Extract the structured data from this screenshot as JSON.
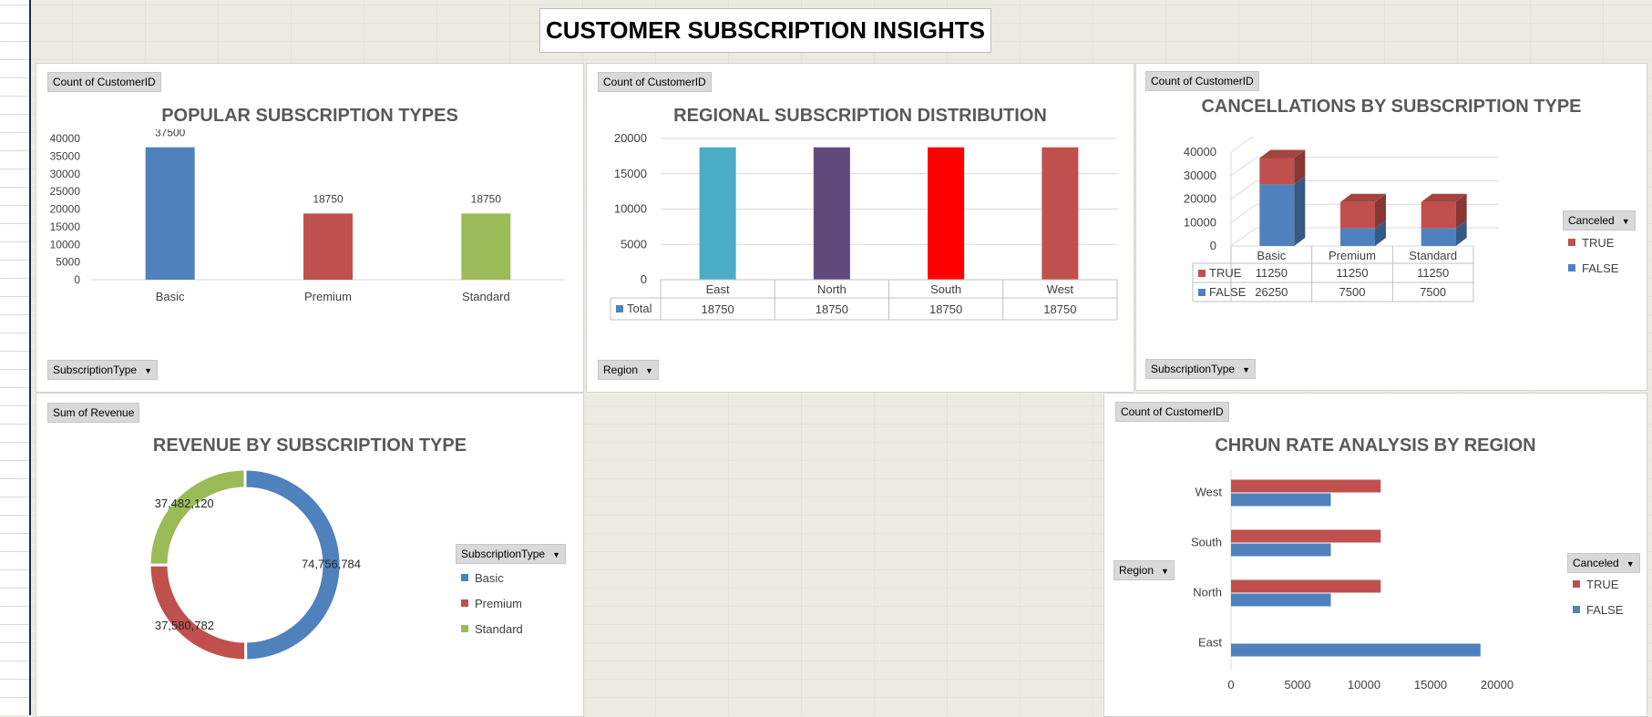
{
  "dashboard_title": "CUSTOMER SUBSCRIPTION INSIGHTS",
  "colors": {
    "blue": "#4f81bd",
    "red": "#c0504d",
    "green": "#9bbb59",
    "teal": "#4bacc6",
    "purple": "#604a7b",
    "bright_red": "#ff0000"
  },
  "panels": {
    "popular": {
      "field_button": "Count of CustomerID",
      "axis_button": "SubscriptionType",
      "title": "POPULAR SUBSCRIPTION TYPES"
    },
    "regional": {
      "field_button": "Count of CustomerID",
      "axis_button": "Region",
      "title": "REGIONAL SUBSCRIPTION DISTRIBUTION",
      "table_series_label": "Total"
    },
    "cancellations": {
      "field_button": "Count of CustomerID",
      "axis_button": "SubscriptionType",
      "legend_button": "Canceled",
      "title": "CANCELLATIONS BY SUBSCRIPTION TYPE"
    },
    "revenue": {
      "field_button": "Sum of Revenue",
      "legend_button": "SubscriptionType",
      "title": "REVENUE BY SUBSCRIPTION TYPE"
    },
    "churn": {
      "field_button": "Count of CustomerID",
      "axis_button": "Region",
      "legend_button": "Canceled",
      "title": "CHRUN RATE ANALYSIS BY REGION"
    }
  },
  "chart_data": [
    {
      "id": "popular",
      "type": "bar",
      "title": "POPULAR SUBSCRIPTION TYPES",
      "categories": [
        "Basic",
        "Premium",
        "Standard"
      ],
      "values": [
        37500,
        18750,
        18750
      ],
      "data_labels": [
        "37500",
        "18750",
        "18750"
      ],
      "bar_colors": [
        "#4f81bd",
        "#c0504d",
        "#9bbb59"
      ],
      "ylim": [
        0,
        40000
      ],
      "yticks": [
        "0",
        "5000",
        "10000",
        "15000",
        "20000",
        "25000",
        "30000",
        "35000",
        "40000"
      ],
      "grid": false
    },
    {
      "id": "regional",
      "type": "bar",
      "title": "REGIONAL SUBSCRIPTION DISTRIBUTION",
      "categories": [
        "East",
        "North",
        "South",
        "West"
      ],
      "series": [
        {
          "name": "Total",
          "values": [
            18750,
            18750,
            18750,
            18750
          ]
        }
      ],
      "table_values": [
        "18750",
        "18750",
        "18750",
        "18750"
      ],
      "bar_colors": [
        "#4bacc6",
        "#604a7b",
        "#ff0000",
        "#c0504d"
      ],
      "ylim": [
        0,
        20000
      ],
      "yticks": [
        "0",
        "5000",
        "10000",
        "15000",
        "20000"
      ],
      "grid": true
    },
    {
      "id": "cancellations",
      "type": "bar",
      "stacked": true,
      "three_d": true,
      "title": "CANCELLATIONS BY SUBSCRIPTION TYPE",
      "categories": [
        "Basic",
        "Premium",
        "Standard"
      ],
      "series": [
        {
          "name": "TRUE",
          "values": [
            11250,
            11250,
            11250
          ],
          "labels": [
            "11250",
            "11250",
            "11250"
          ],
          "color": "#c0504d"
        },
        {
          "name": "FALSE",
          "values": [
            26250,
            7500,
            7500
          ],
          "labels": [
            "26250",
            "7500",
            "7500"
          ],
          "color": "#4f81bd"
        }
      ],
      "ylim": [
        0,
        40000
      ],
      "yticks": [
        "0",
        "10000",
        "20000",
        "30000",
        "40000"
      ],
      "legend": "right"
    },
    {
      "id": "revenue",
      "type": "pie",
      "donut": true,
      "title": "REVENUE BY SUBSCRIPTION TYPE",
      "categories": [
        "Basic",
        "Premium",
        "Standard"
      ],
      "values": [
        74756784,
        37580782,
        37482120
      ],
      "labels": [
        "74,756,784",
        "37,580,782",
        "37,482,120"
      ],
      "colors": [
        "#4f81bd",
        "#c0504d",
        "#9bbb59"
      ],
      "legend": "right"
    },
    {
      "id": "churn",
      "type": "bar",
      "orientation": "horizontal",
      "title": "CHRUN RATE ANALYSIS BY REGION",
      "categories": [
        "East",
        "North",
        "South",
        "West"
      ],
      "series": [
        {
          "name": "TRUE",
          "values": [
            0,
            11250,
            11250,
            11250
          ],
          "color": "#c0504d"
        },
        {
          "name": "FALSE",
          "values": [
            18750,
            7500,
            7500,
            7500
          ],
          "color": "#4f81bd"
        }
      ],
      "xlim": [
        0,
        20000
      ],
      "xticks": [
        "0",
        "5000",
        "10000",
        "15000",
        "20000"
      ],
      "legend": "right"
    }
  ]
}
